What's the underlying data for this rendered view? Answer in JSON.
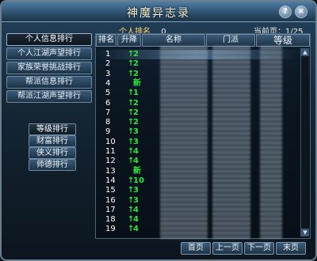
{
  "window": {
    "title": "神魔异志录",
    "help_label": "?",
    "close_label": "×"
  },
  "info": {
    "my_rank_label": "个人排名",
    "my_rank_value": "0",
    "page_label": "当前页：",
    "page_value": "1/25"
  },
  "sidebar": {
    "items": [
      {
        "label": "个人信息排行",
        "active": true
      },
      {
        "label": "个人江湖声望排行",
        "active": false
      },
      {
        "label": "家族荣誉挑战排行",
        "active": false
      },
      {
        "label": "帮派信息排行",
        "active": false
      },
      {
        "label": "帮派江湖声望排行",
        "active": false
      }
    ],
    "categories": [
      {
        "label": "等级排行",
        "active": true
      },
      {
        "label": "财富排行",
        "active": false
      },
      {
        "label": "侠义排行",
        "active": false
      },
      {
        "label": "师德排行",
        "active": false
      }
    ]
  },
  "table": {
    "headers": [
      "排名",
      "升降",
      "名称",
      "门派",
      "等级"
    ],
    "rows": [
      {
        "rank": "1",
        "arrow": "↑",
        "change": "2"
      },
      {
        "rank": "2",
        "arrow": "↑",
        "change": "2"
      },
      {
        "rank": "3",
        "arrow": "↑",
        "change": "2"
      },
      {
        "rank": "4",
        "arrow": "",
        "change": "新"
      },
      {
        "rank": "5",
        "arrow": "↑",
        "change": "1"
      },
      {
        "rank": "6",
        "arrow": "↑",
        "change": "2"
      },
      {
        "rank": "7",
        "arrow": "↑",
        "change": "2"
      },
      {
        "rank": "8",
        "arrow": "↑",
        "change": "2"
      },
      {
        "rank": "9",
        "arrow": "↑",
        "change": "3"
      },
      {
        "rank": "10",
        "arrow": "↑",
        "change": "3"
      },
      {
        "rank": "11",
        "arrow": "↑",
        "change": "4"
      },
      {
        "rank": "12",
        "arrow": "↑",
        "change": "4"
      },
      {
        "rank": "13",
        "arrow": "",
        "change": "新"
      },
      {
        "rank": "14",
        "arrow": "↑",
        "change": "10"
      },
      {
        "rank": "15",
        "arrow": "↑",
        "change": "3"
      },
      {
        "rank": "16",
        "arrow": "↑",
        "change": "3"
      },
      {
        "rank": "17",
        "arrow": "↑",
        "change": "4"
      },
      {
        "rank": "18",
        "arrow": "↑",
        "change": "4"
      },
      {
        "rank": "19",
        "arrow": "↑",
        "change": "4"
      }
    ]
  },
  "pager": {
    "first": "首页",
    "prev": "上一页",
    "next": "下一页",
    "last": "末页"
  },
  "colors": {
    "up_arrow": "#2ee640",
    "accent_label": "#ffd66b"
  }
}
